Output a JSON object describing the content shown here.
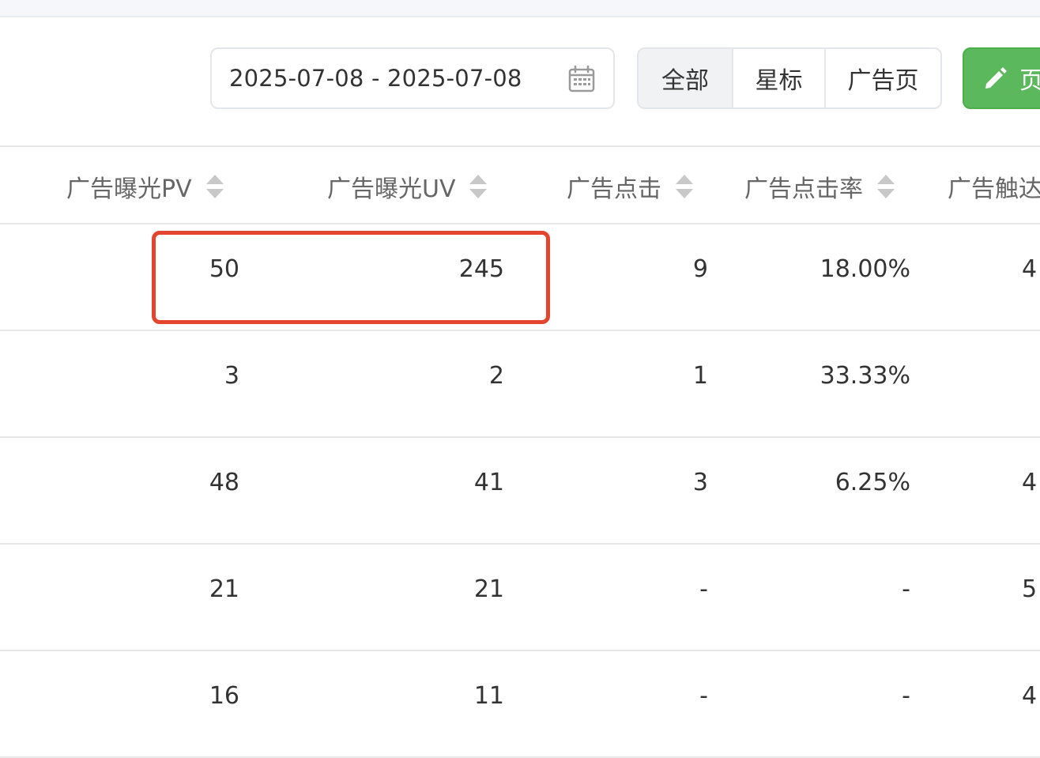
{
  "toolbar": {
    "date_range": "2025-07-08 - 2025-07-08",
    "date_icon": "calendar-icon",
    "filters": [
      {
        "label": "全部",
        "active": true
      },
      {
        "label": "星标",
        "active": false
      },
      {
        "label": "广告页",
        "active": false
      }
    ],
    "action_button": {
      "label": "页",
      "icon": "pencil-icon",
      "color": "#5cb85c"
    }
  },
  "table": {
    "columns": [
      {
        "label": "广告曝光PV",
        "sortable": true
      },
      {
        "label": "广告曝光UV",
        "sortable": true
      },
      {
        "label": "广告点击",
        "sortable": true
      },
      {
        "label": "广告点击率",
        "sortable": true
      },
      {
        "label": "广告触达",
        "sortable": false
      }
    ],
    "rows": [
      [
        "50",
        "245",
        "9",
        "18.00%",
        "4"
      ],
      [
        "3",
        "2",
        "1",
        "33.33%",
        ""
      ],
      [
        "48",
        "41",
        "3",
        "6.25%",
        "4"
      ],
      [
        "21",
        "21",
        "-",
        "-",
        "5"
      ],
      [
        "16",
        "11",
        "-",
        "-",
        "4"
      ]
    ]
  },
  "highlight": {
    "color": "#e3452f"
  }
}
